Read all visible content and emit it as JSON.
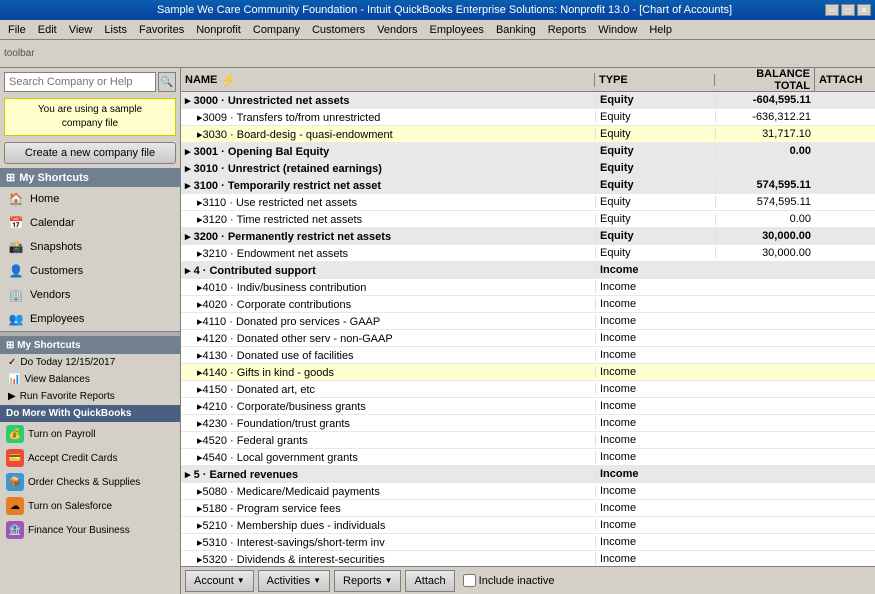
{
  "titleBar": {
    "title": "Sample We Care Community Foundation  -  Intuit QuickBooks Enterprise Solutions: Nonprofit 13.0 - [Chart of Accounts]",
    "minBtn": "─",
    "maxBtn": "□",
    "closeBtn": "✕"
  },
  "menuBar": {
    "items": [
      "File",
      "Edit",
      "View",
      "Lists",
      "Favorites",
      "Nonprofit",
      "Company",
      "Customers",
      "Vendors",
      "Employees",
      "Banking",
      "Reports",
      "Window",
      "Help"
    ]
  },
  "sidebar": {
    "searchPlaceholder": "Search Company or Help",
    "banner": {
      "line1": "You are using a sample",
      "line2": "company file"
    },
    "createBtn": "Create a new company file",
    "myShortcuts": "My Shortcuts",
    "navItems": [
      {
        "icon": "🏠",
        "label": "Home"
      },
      {
        "icon": "📅",
        "label": "Calendar"
      },
      {
        "icon": "📸",
        "label": "Snapshots"
      },
      {
        "icon": "👤",
        "label": "Customers"
      },
      {
        "icon": "🏢",
        "label": "Vendors"
      },
      {
        "icon": "👥",
        "label": "Employees"
      }
    ],
    "myShortcuts2": "My Shortcuts",
    "subItems": [
      {
        "icon": "✓",
        "label": "Do Today 12/15/2017"
      },
      {
        "icon": "📊",
        "label": "View Balances"
      },
      {
        "icon": "▶",
        "label": "Run Favorite Reports"
      }
    ],
    "doMoreHeader": "Do More With QuickBooks",
    "doMoreItems": [
      {
        "icon": "💰",
        "color": "#2ecc71",
        "label": "Turn on Payroll"
      },
      {
        "icon": "💳",
        "color": "#e74c3c",
        "label": "Accept Credit Cards"
      },
      {
        "icon": "📦",
        "color": "#3498db",
        "label": "Order Checks & Supplies"
      },
      {
        "icon": "☁",
        "color": "#e67e22",
        "label": "Turn on Salesforce"
      },
      {
        "icon": "🏦",
        "color": "#9b59b6",
        "label": "Finance Your Business"
      }
    ]
  },
  "table": {
    "columns": {
      "name": "NAME",
      "type": "TYPE",
      "balance": "BALANCE TOTAL",
      "attach": "ATTACH"
    },
    "rows": [
      {
        "name": "▸ 3000 · Unrestricted net assets",
        "type": "Equity",
        "balance": "-604,595.11",
        "indent": 0,
        "bold": true
      },
      {
        "name": "▸3009 · Transfers to/from unrestricted",
        "type": "Equity",
        "balance": "-636,312.21",
        "indent": 1
      },
      {
        "name": "▸3030 · Board-desig - quasi-endowment",
        "type": "Equity",
        "balance": "31,717.10",
        "indent": 1,
        "highlight": true
      },
      {
        "name": "▸ 3001 · Opening Bal Equity",
        "type": "Equity",
        "balance": "0.00",
        "indent": 0,
        "bold": true
      },
      {
        "name": "▸ 3010 · Unrestrict (retained earnings)",
        "type": "Equity",
        "balance": "",
        "indent": 0,
        "bold": true
      },
      {
        "name": "▸ 3100 · Temporarily restrict net asset",
        "type": "Equity",
        "balance": "574,595.11",
        "indent": 0,
        "bold": true
      },
      {
        "name": "▸3110 · Use restricted net assets",
        "type": "Equity",
        "balance": "574,595.11",
        "indent": 1
      },
      {
        "name": "▸3120 · Time restricted net assets",
        "type": "Equity",
        "balance": "0.00",
        "indent": 1
      },
      {
        "name": "▸ 3200 · Permanently restrict net assets",
        "type": "Equity",
        "balance": "30,000.00",
        "indent": 0,
        "bold": true
      },
      {
        "name": "▸3210 · Endowment net assets",
        "type": "Equity",
        "balance": "30,000.00",
        "indent": 1
      },
      {
        "name": "▸ 4 · Contributed support",
        "type": "Income",
        "balance": "",
        "indent": 0,
        "bold": true
      },
      {
        "name": "▸4010 · Indiv/business contribution",
        "type": "Income",
        "balance": "",
        "indent": 1
      },
      {
        "name": "▸4020 · Corporate contributions",
        "type": "Income",
        "balance": "",
        "indent": 1
      },
      {
        "name": "▸4110 · Donated pro services - GAAP",
        "type": "Income",
        "balance": "",
        "indent": 1
      },
      {
        "name": "▸4120 · Donated other serv - non-GAAP",
        "type": "Income",
        "balance": "",
        "indent": 1
      },
      {
        "name": "▸4130 · Donated use of facilities",
        "type": "Income",
        "balance": "",
        "indent": 1
      },
      {
        "name": "▸4140 · Gifts in kind - goods",
        "type": "Income",
        "balance": "",
        "indent": 1,
        "highlight": true
      },
      {
        "name": "▸4150 · Donated art, etc",
        "type": "Income",
        "balance": "",
        "indent": 1
      },
      {
        "name": "▸4210 · Corporate/business grants",
        "type": "Income",
        "balance": "",
        "indent": 1
      },
      {
        "name": "▸4230 · Foundation/trust grants",
        "type": "Income",
        "balance": "",
        "indent": 1
      },
      {
        "name": "▸4520 · Federal grants",
        "type": "Income",
        "balance": "",
        "indent": 1
      },
      {
        "name": "▸4540 · Local government grants",
        "type": "Income",
        "balance": "",
        "indent": 1
      },
      {
        "name": "▸ 5 · Earned revenues",
        "type": "Income",
        "balance": "",
        "indent": 0,
        "bold": true
      },
      {
        "name": "▸5080 · Medicare/Medicaid payments",
        "type": "Income",
        "balance": "",
        "indent": 1
      },
      {
        "name": "▸5180 · Program service fees",
        "type": "Income",
        "balance": "",
        "indent": 1
      },
      {
        "name": "▸5210 · Membership dues - individuals",
        "type": "Income",
        "balance": "",
        "indent": 1
      },
      {
        "name": "▸5310 · Interest-savings/short-term inv",
        "type": "Income",
        "balance": "",
        "indent": 1
      },
      {
        "name": "▸5320 · Dividends & interest-securities",
        "type": "Income",
        "balance": "",
        "indent": 1
      }
    ]
  },
  "bottomBar": {
    "accountBtn": "Account",
    "activitiesBtn": "Activities",
    "reportsBtn": "Reports",
    "attachBtn": "Attach",
    "includeInactive": "Include inactive"
  }
}
